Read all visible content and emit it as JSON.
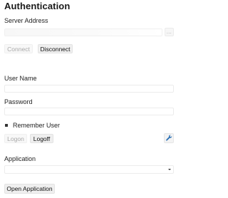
{
  "section": {
    "title": "Authentication"
  },
  "server": {
    "label": "Server Address",
    "value": "",
    "browse_label": "..."
  },
  "connection": {
    "connect_label": "Connect",
    "disconnect_label": "Disconnect"
  },
  "user": {
    "username_label": "User Name",
    "username_value": "",
    "password_label": "Password",
    "password_value": "",
    "remember_label": "Remember User",
    "remember_checked": true
  },
  "logon": {
    "logon_label": "Logon",
    "logoff_label": "Logoff",
    "settings_icon": "wrench-icon"
  },
  "application": {
    "label": "Application",
    "selected_value": "",
    "open_label": "Open Application"
  },
  "colors": {
    "disabled_text": "#a8a8a8",
    "button_bg": "#efefef",
    "icon_blue": "#2a6fb4"
  }
}
